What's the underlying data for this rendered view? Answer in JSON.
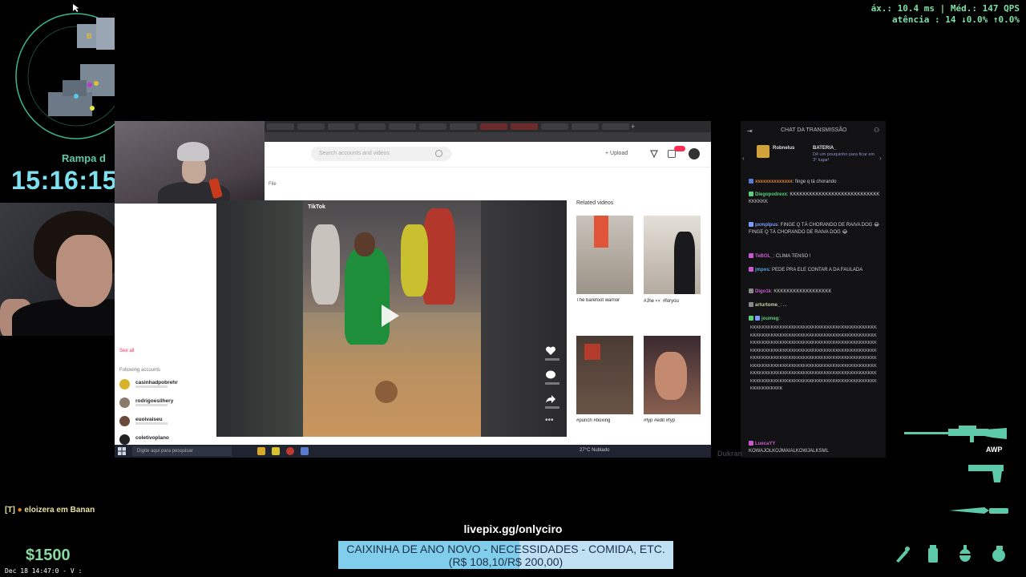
{
  "hud": {
    "location": "Rampa d",
    "clock": "15:16:15",
    "radar_marker": "B",
    "perf_line1": "áx.: 10.4 ms | Méd.: 147 QPS",
    "perf_line2": "atência : 14   ↓0.0%  ↑0.0%",
    "killfeed_prefix": "[T]",
    "killfeed_text": "eloizera em Banan",
    "money": "$1500",
    "timestamp": "Dec 18 14:47:0 - V :",
    "weapon_primary": "AWP",
    "accent_color": "#7fe0a7"
  },
  "browser": {
    "search_placeholder": "Search accounts and videos",
    "upload_label": "Upload",
    "file_label": "File",
    "see_all": "See all",
    "following_title": "Following accounts",
    "following": [
      {
        "name": "casinhadpobrehr",
        "color": "#d8b32a"
      },
      {
        "name": "rodrigoesilhery",
        "color": "#8b7a6a"
      },
      {
        "name": "euoivaiseu",
        "color": "#6a4a3a"
      },
      {
        "name": "coletivoplano",
        "color": "#222222"
      }
    ],
    "video_brand": "TikTok",
    "related_title": "Related videos",
    "related": [
      {
        "caption": "The barefoot warrior"
      },
      {
        "caption": "#Jhe 👀 #foryou"
      },
      {
        "caption": "#punch #boxing"
      },
      {
        "caption": "#fyp #edit #fyp"
      }
    ],
    "taskbar_search": "Digite aqui para pesquisar",
    "tray_text": "27°C Nublado"
  },
  "chat": {
    "title": "CHAT DA TRANSMISSÃO",
    "pinned": {
      "user": "Robnelus",
      "user2": "BATERIA_",
      "message": "Dê um pouquinho para ficar em 3° lugar!"
    },
    "lines": [
      {
        "user": "xxxxxxxxxxxxxx",
        "color": "#e0873a",
        "text": ": finge q tá chorando"
      },
      {
        "user": "Diegopodrexx",
        "color": "#5ad07a",
        "text": ": KKKKKKKKKKKKKKKKKKKKKKKKKKKKKKKKKK"
      },
      {
        "user": "pxmplpus",
        "color": "#7a9bff",
        "text": ": FINGE Q TÁ CHORANDO DE RAIVA DOG 😂 FINGE Q TÁ CHORANDO DE RAIVA DOG 😂"
      },
      {
        "user": "TeBOL_",
        "color": "#c85ad0",
        "text": ": CLIMA TENSO !"
      },
      {
        "user": "jmpos",
        "color": "#5aa0e0",
        "text": ": PEDE PRA ELE CONTAR A DA FAULADA"
      },
      {
        "user": "Digo1k",
        "color": "#c85ad0",
        "text": ": KKKKKKKKKKKKKKKKKK"
      },
      {
        "user": "arturtome_",
        "color": "#ccccaa",
        "text": ": ..."
      },
      {
        "user": "joumeg",
        "color": "#5ad07a",
        "text": ":"
      }
    ],
    "spam": "KKKKKKKKKKKKKKKKKKKKKKKKKKKKKKKKKKKKKKKKKKKKKKKKKKKKKKKKKKKKKKKKKKKKKKKKKKKKKKKKKKKKKKKKKKKKKKKKKKKKKKKKKKKKKKKKKKKKKKKKKKKKKKKKKKKKKKKKKKKKKKKKKKKKKKKKKKKKKKKKKKKKKKKKKKKKKKKKKKKKKKKKKKKKKKKKKKKKKKKKKKKKKKKKKKKKKKKKKKKKKKKKKKKKKKKKKKKKKKKKKKKKKKKKKKKKKKKKKKKKKKKKKKKKKKKKKKKKKKKKKKKKKKKKKKKKKKKKKKKKKKKKKKKKKKKKKKKKKKKKKKKKKKKKKKKKKKKKKKKKKKKKKKKKKKKKKKK",
    "last_user": "LuecaYY",
    "last_text": "KOWAJOLKOJMAIALKOWJALKSML"
  },
  "watermark": "Dukran",
  "donation": {
    "link": "livepix.gg/onlyciro",
    "title": "CAIXINHA DE ANO NOVO - NECESSIDADES - COMIDA, ETC.",
    "amount": "(R$ 108,10/R$ 200,00)",
    "progress": 0.54,
    "bar_color": "#34b7e3"
  }
}
